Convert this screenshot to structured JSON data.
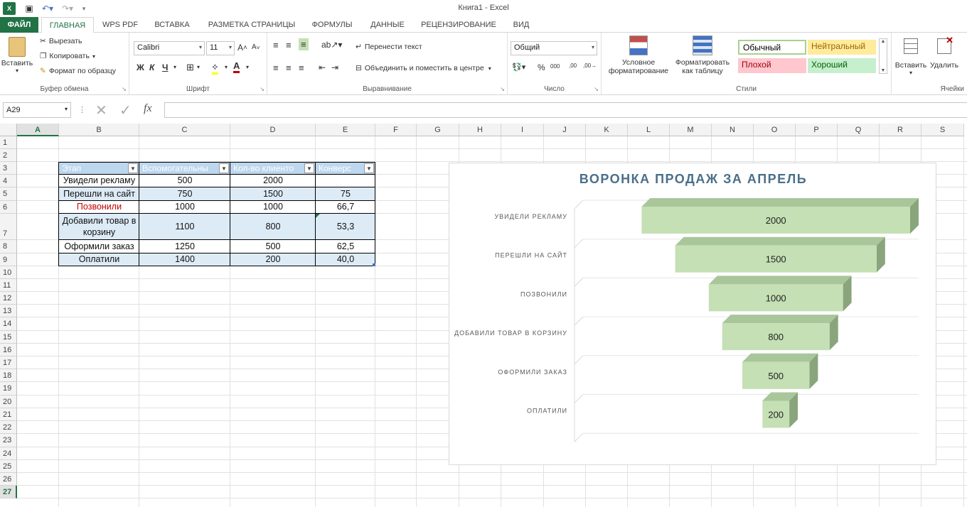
{
  "window": {
    "title": "Книга1 - Excel"
  },
  "tabs": [
    "ФАЙЛ",
    "ГЛАВНАЯ",
    "WPS PDF",
    "ВСТАВКА",
    "РАЗМЕТКА СТРАНИЦЫ",
    "ФОРМУЛЫ",
    "ДАННЫЕ",
    "РЕЦЕНЗИРОВАНИЕ",
    "ВИД"
  ],
  "ribbon": {
    "clipboard": {
      "paste": "Вставить",
      "cut": "Вырезать",
      "copy": "Копировать",
      "format_painter": "Формат по образцу",
      "label": "Буфер обмена"
    },
    "font": {
      "name": "Calibri",
      "size": "11",
      "bold": "Ж",
      "italic": "К",
      "underline": "Ч",
      "label": "Шрифт"
    },
    "alignment": {
      "wrap": "Перенести текст",
      "merge": "Объединить и поместить в центре",
      "label": "Выравнивание"
    },
    "number": {
      "format": "Общий",
      "percent": "%",
      "thousands": "000",
      "inc": ",00",
      "label": "Число"
    },
    "styles": {
      "conditional": "Условное",
      "conditional2": "форматирование",
      "as_table": "Форматировать",
      "as_table2": "как таблицу",
      "normal": "Обычный",
      "neutral": "Нейтральный",
      "bad": "Плохой",
      "good": "Хороший",
      "label": "Стили"
    },
    "cells": {
      "insert": "Вставить",
      "delete": "Удалить",
      "label": "Ячейки"
    }
  },
  "formula_bar": {
    "name_box": "A29",
    "fx": "fx",
    "value": ""
  },
  "columns": [
    "A",
    "B",
    "C",
    "D",
    "E",
    "F",
    "G",
    "H",
    "I",
    "J",
    "K",
    "L",
    "M",
    "N",
    "O",
    "P",
    "Q",
    "R",
    "S"
  ],
  "rows": [
    "1",
    "2",
    "3",
    "4",
    "5",
    "6",
    "7",
    "8",
    "9",
    "10",
    "11",
    "12",
    "13",
    "14",
    "15",
    "16",
    "17",
    "18",
    "19",
    "20",
    "21",
    "22",
    "23",
    "24",
    "25",
    "26",
    "27"
  ],
  "table": {
    "headers": [
      "Этап",
      "Вспомогательны",
      "Кол-во клиенто",
      "Конверс"
    ],
    "rows": [
      [
        "Увидели рекламу",
        "500",
        "2000",
        ""
      ],
      [
        "Перешли на сайт",
        "750",
        "1500",
        "75"
      ],
      [
        "Позвонили",
        "1000",
        "1000",
        "66,7"
      ],
      [
        "Добавили товар в корзину",
        "1100",
        "800",
        "53,3"
      ],
      [
        "Оформили заказ",
        "1250",
        "500",
        "62,5"
      ],
      [
        "Оплатили",
        "1400",
        "200",
        "40,0"
      ]
    ]
  },
  "colors": {
    "excel_green": "#217346",
    "bar_face": "#c5e0b4",
    "bar_top": "#a9c69b",
    "bar_side": "#8aa57c",
    "title": "#4a6f8a",
    "red_text": "#c00000"
  },
  "chart_data": {
    "type": "bar",
    "title": "ВОРОНКА ПРОДАЖ ЗА АПРЕЛЬ",
    "categories": [
      "УВИДЕЛИ РЕКЛАМУ",
      "ПЕРЕШЛИ НА САЙТ",
      "ПОЗВОНИЛИ",
      "ДОБАВИЛИ ТОВАР В КОРЗИНУ",
      "ОФОРМИЛИ ЗАКАЗ",
      "ОПЛАТИЛИ"
    ],
    "offset": [
      500,
      750,
      1000,
      1100,
      1250,
      1400
    ],
    "values": [
      2000,
      1500,
      1000,
      800,
      500,
      200
    ],
    "orientation": "horizontal-stacked-funnel",
    "grid": true,
    "legend": "none"
  }
}
